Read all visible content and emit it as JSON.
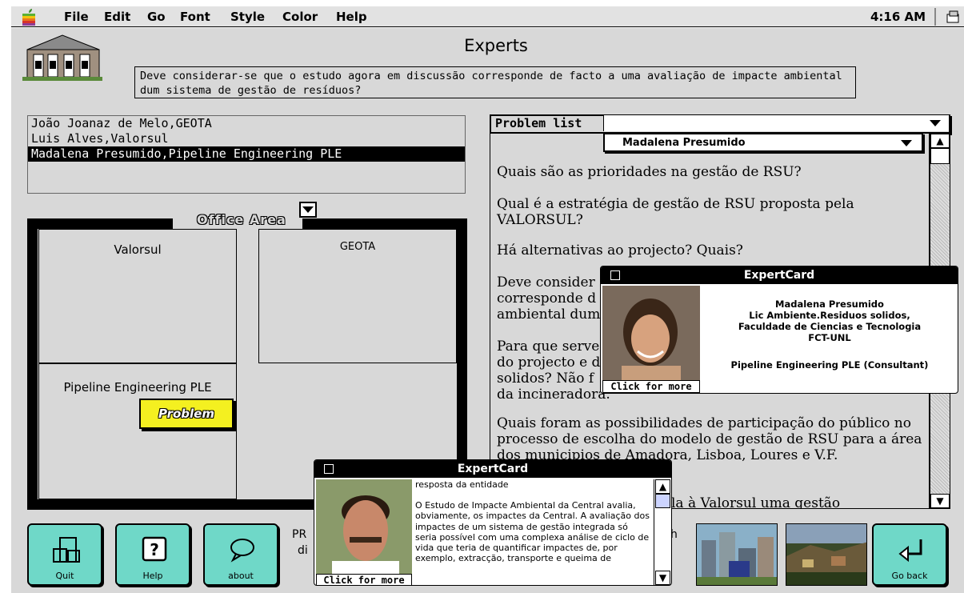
{
  "menubar": {
    "items": [
      "File",
      "Edit",
      "Go",
      "Font",
      "Style",
      "Color",
      "Help"
    ],
    "clock": "4:16 AM"
  },
  "window": {
    "title": "Experts",
    "question": "Deve considerar-se que o estudo agora em discussão corresponde de facto a uma avaliação de impacte ambiental dum sistema de gestão de resíduos?"
  },
  "expert_list": {
    "items": [
      "João Joanaz de Melo,GEOTA",
      "Luis Alves,Valorsul",
      "Madalena Presumido,Pipeline Engineering PLE"
    ],
    "selected_index": 2
  },
  "office_area": {
    "label": "Office Area",
    "rooms": [
      "Valorsul",
      "GEOTA",
      "Pipeline Engineering PLE"
    ],
    "problem_button": "Problem"
  },
  "problem_list": {
    "label": "Problem list",
    "selected_value": "",
    "expert_selected": "Madalena Presumido",
    "questions": [
      "Quais são as prioridades na gestão de RSU?",
      "Qual é a estratégia de gestão de RSU proposta pela VALORSUL?",
      "Há alternativas ao projecto? Quais?",
      "Deve consider",
      "corresponde d",
      "ambiental dum",
      "Para que serve",
      "do projecto e d",
      "solidos? Não f",
      "da incineradora.",
      "Quais foram as possibilidades de participação do público no processo de escolha do modelo de gestão de RSU para a área dos municipios de Amadora, Lisboa, Loures e V.F.",
      "la à Valorsul uma gestão"
    ]
  },
  "expert_card_1": {
    "title": "ExpertCard",
    "more_button": "Click for more",
    "name": "Madalena Presumido",
    "specialty": "Lic Ambiente.Residuos solidos,",
    "school": "Faculdade de Ciencias e Tecnologia",
    "school_short": "FCT-UNL",
    "organization": "Pipeline Engineering PLE (Consultant)"
  },
  "expert_card_2": {
    "title": "ExpertCard",
    "more_button": "Click for more",
    "heading": "resposta da entidade",
    "body": "O Estudo de Impacte Ambiental da Central avalia, obviamente, os impactes da Central. A avaliação dos impactes de um sistema de gestão integrada só seria possível com uma complexa análise de ciclo de vida que teria de quantificar impactes de, por exemplo, extracção, transporte e queima de"
  },
  "bottom": {
    "buttons": [
      "Quit",
      "Help",
      "about",
      "Go back"
    ],
    "text_line1": "PR",
    "text_line2": "di",
    "text_tail": "h"
  },
  "colors": {
    "nav_button": "#6fd8c8",
    "problem_button": "#f4f020",
    "window_bg": "#d8d8d8",
    "selection": "#000000"
  }
}
